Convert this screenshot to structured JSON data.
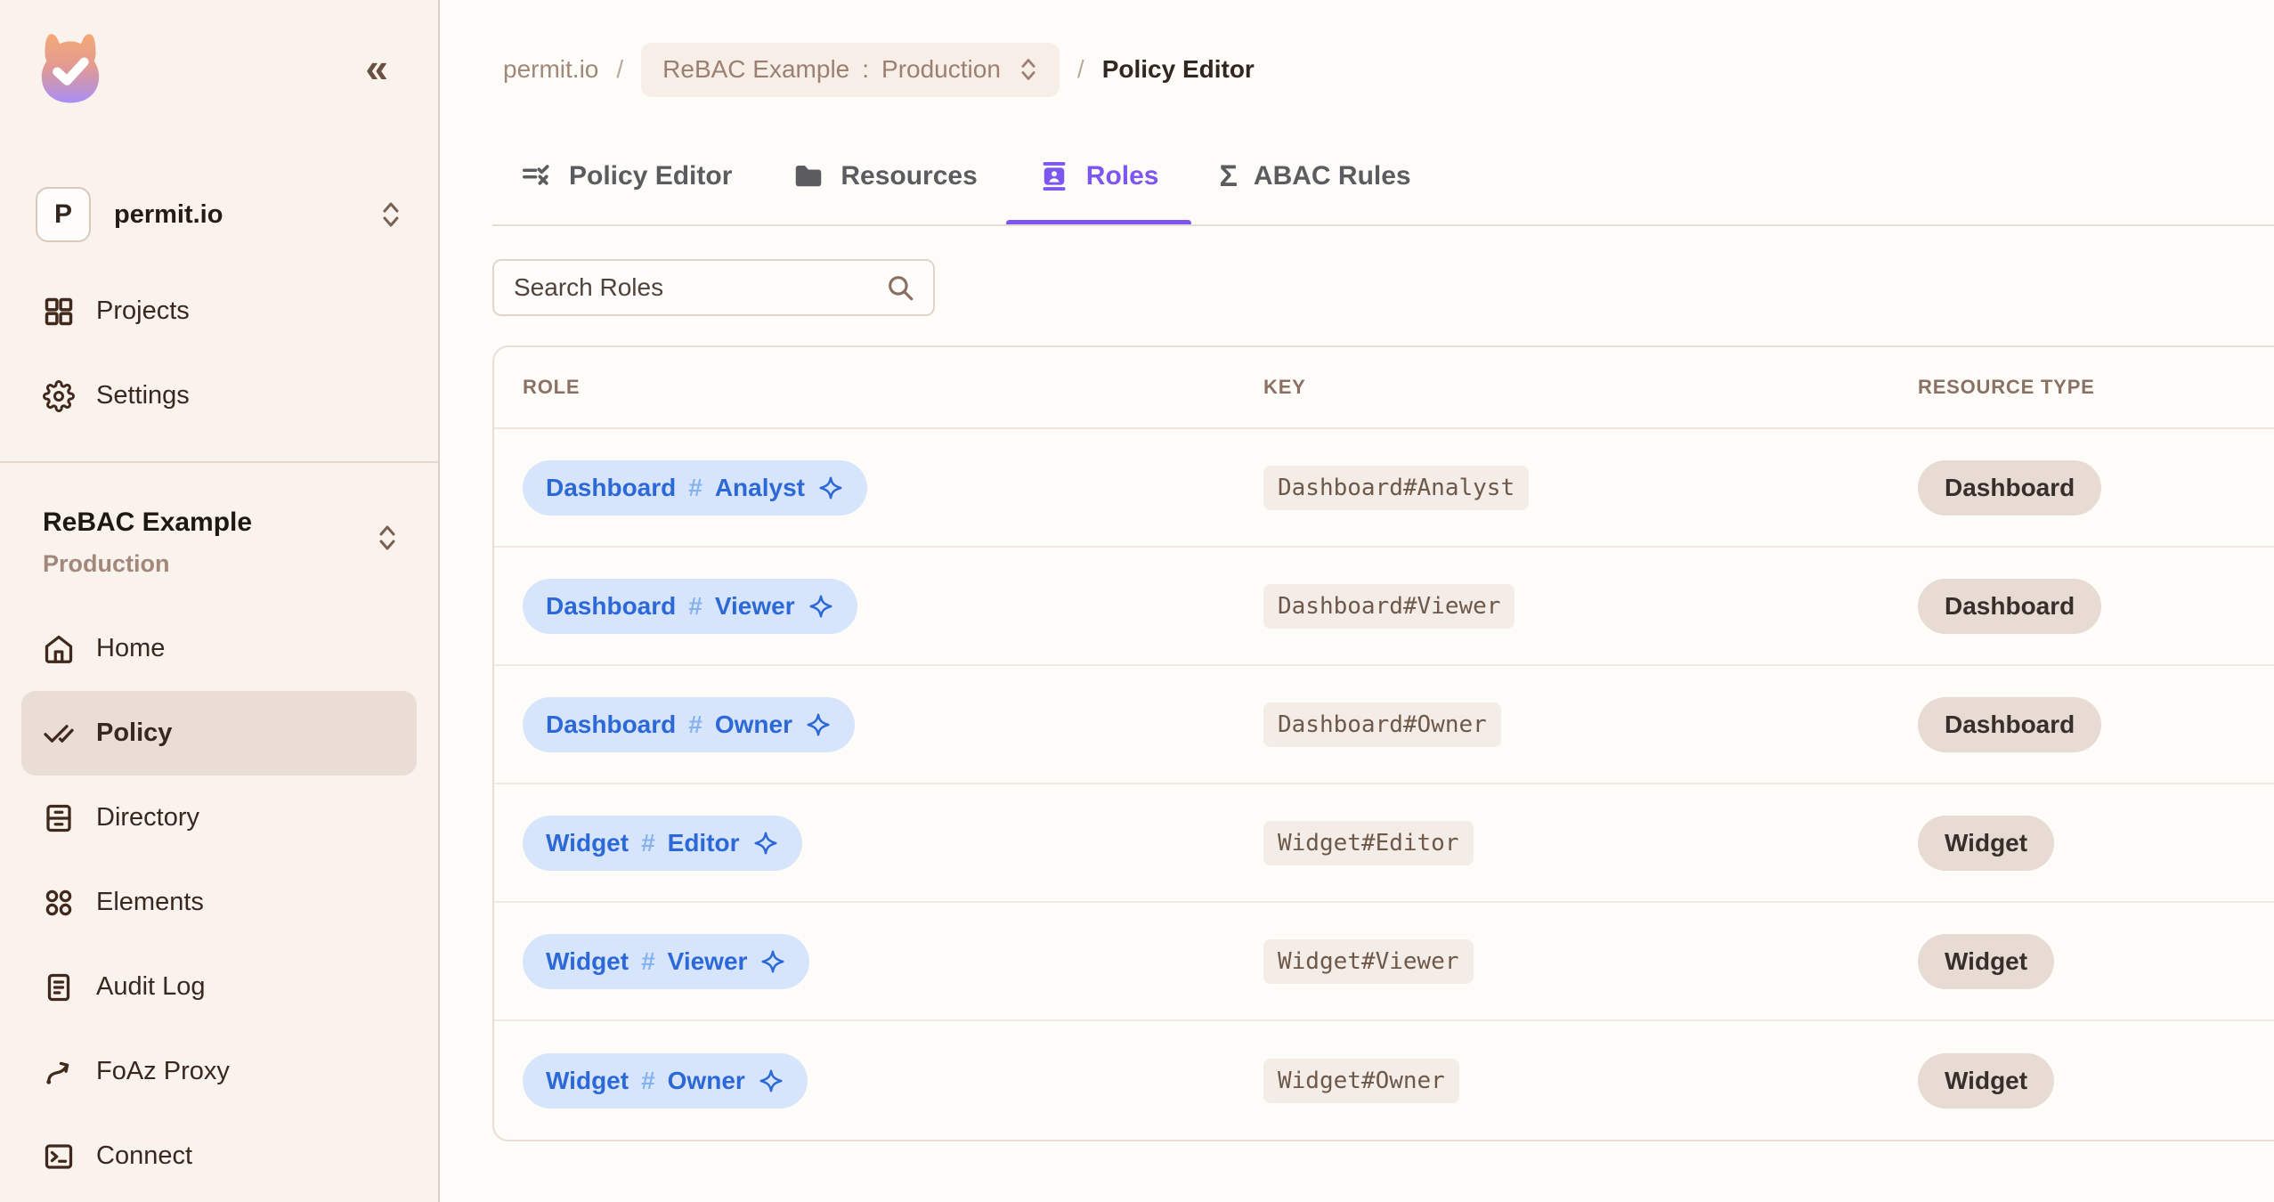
{
  "sidebar": {
    "collapse_icon": "«",
    "org": {
      "initial": "P",
      "name": "permit.io"
    },
    "top_nav": [
      {
        "label": "Projects"
      },
      {
        "label": "Settings"
      }
    ],
    "project": {
      "name": "ReBAC Example",
      "environment": "Production"
    },
    "nav": [
      {
        "label": "Home"
      },
      {
        "label": "Policy",
        "active": true
      },
      {
        "label": "Directory"
      },
      {
        "label": "Elements"
      },
      {
        "label": "Audit Log"
      },
      {
        "label": "FoAz Proxy"
      },
      {
        "label": "Connect"
      }
    ]
  },
  "breadcrumb": {
    "org": "permit.io",
    "separator": "/",
    "pill": {
      "name": "ReBAC Example",
      "colon": ":",
      "env": "Production"
    },
    "page": "Policy Editor"
  },
  "tabs": [
    {
      "label": "Policy Editor"
    },
    {
      "label": "Resources"
    },
    {
      "label": "Roles",
      "active": true
    },
    {
      "label": "ABAC Rules",
      "icon_glyph": "Σ"
    }
  ],
  "search": {
    "placeholder": "Search Roles"
  },
  "table": {
    "columns": [
      "ROLE",
      "KEY",
      "RESOURCE TYPE"
    ],
    "rows": [
      {
        "resource": "Dashboard",
        "hash": "#",
        "role_name": "Analyst",
        "key": "Dashboard#Analyst",
        "resource_type": "Dashboard"
      },
      {
        "resource": "Dashboard",
        "hash": "#",
        "role_name": "Viewer",
        "key": "Dashboard#Viewer",
        "resource_type": "Dashboard"
      },
      {
        "resource": "Dashboard",
        "hash": "#",
        "role_name": "Owner",
        "key": "Dashboard#Owner",
        "resource_type": "Dashboard"
      },
      {
        "resource": "Widget",
        "hash": "#",
        "role_name": "Editor",
        "key": "Widget#Editor",
        "resource_type": "Widget"
      },
      {
        "resource": "Widget",
        "hash": "#",
        "role_name": "Viewer",
        "key": "Widget#Viewer",
        "resource_type": "Widget"
      },
      {
        "resource": "Widget",
        "hash": "#",
        "role_name": "Owner",
        "key": "Widget#Owner",
        "resource_type": "Widget"
      }
    ]
  },
  "colors": {
    "accent_purple": "#7d55ef",
    "role_blue": "#2d68d8",
    "role_blue_bg": "#d6e5fb",
    "sidebar_bg": "#faf3ed",
    "main_bg": "#fdfcf9",
    "active_item_bg": "#e9ddd5",
    "resource_pill_bg": "#e7dbd3",
    "key_chip_bg": "#f4ece6"
  }
}
